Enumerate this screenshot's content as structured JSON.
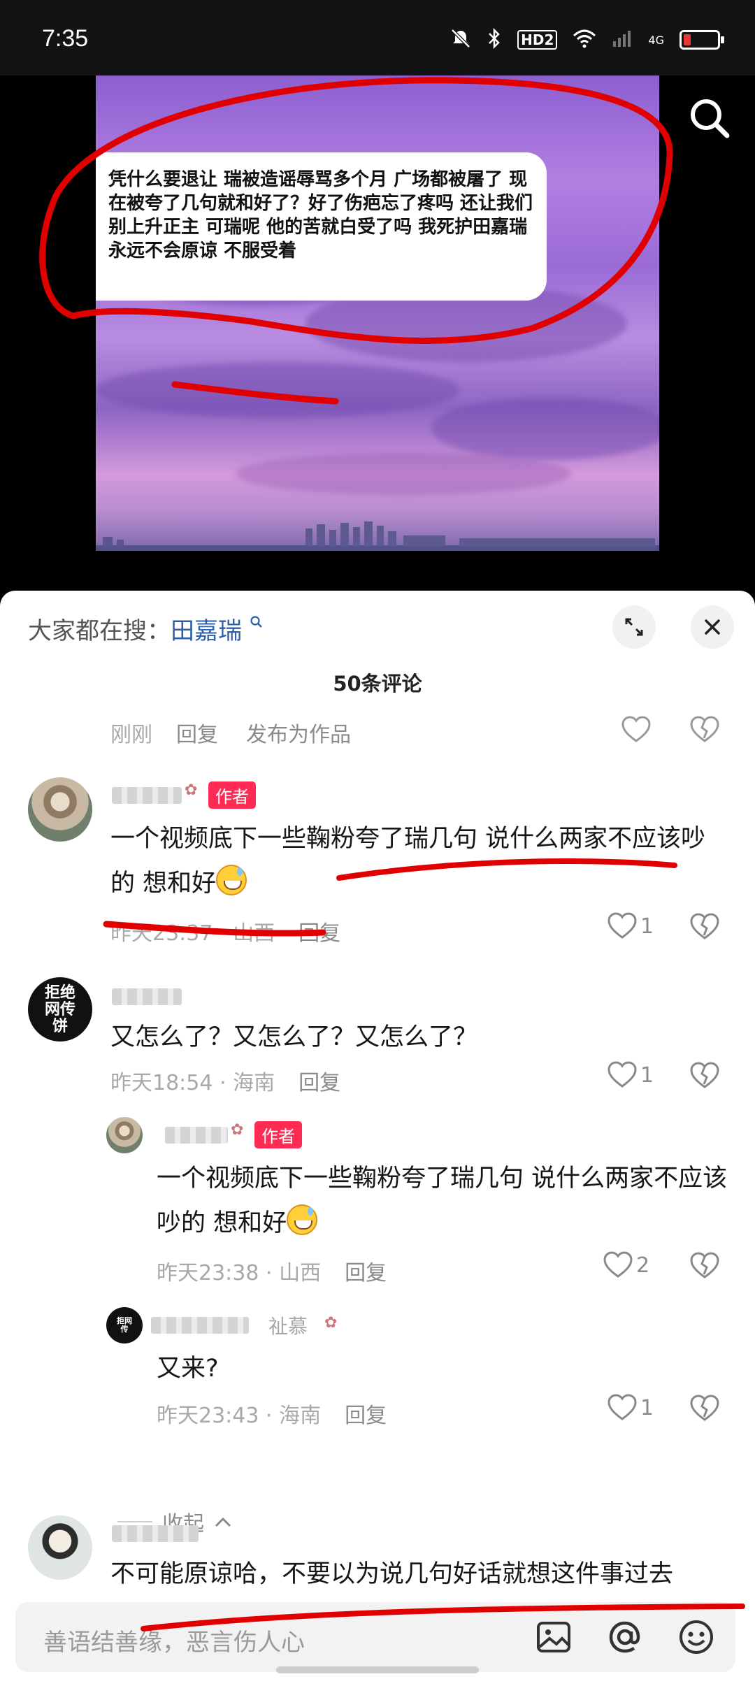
{
  "status_bar": {
    "time": "7:35",
    "hd_label": "HD2",
    "signal_label": "4G"
  },
  "video": {
    "overlay_text": "凭什么要退让 瑞被造谣辱骂多个月 广场都被屠了 现在被夸了几句就和好了？好了伤疤忘了疼吗 还让我们别上升正主 可瑞呢 他的苦就白受了吗 我死护田嘉瑞 永远不会原谅 不服受着"
  },
  "comments_panel": {
    "search_prefix": "大家都在搜：",
    "search_term": "田嘉瑞",
    "count_label": "50条评论",
    "top_row": {
      "time": "刚刚",
      "reply": "回复",
      "publish": "发布为作品"
    },
    "comments": [
      {
        "author_tag": "作者",
        "text": "一个视频底下一些鞠粉夸了瑞几句 说什么两家不应该吵的 想和好",
        "time": "昨天23:37 · 山西",
        "reply": "回复",
        "likes": "1"
      },
      {
        "avatar_text": "拒绝网传饼",
        "text": "又怎么了？又怎么了？又怎么了？",
        "time": "昨天18:54 · 海南",
        "reply": "回复",
        "likes": "1"
      },
      {
        "author_tag": "作者",
        "text": "一个视频底下一些鞠粉夸了瑞几句 说什么两家不应该吵的 想和好",
        "time": "昨天23:38 · 山西",
        "reply": "回复",
        "likes": "2"
      },
      {
        "avatar_text": "拒网传",
        "reply_to": "祉慕",
        "text": "又来?",
        "time": "昨天23:43 · 海南",
        "reply": "回复",
        "likes": "1"
      },
      {
        "text": "不可能原谅哈，不要以为说几句好话就想这件事过去"
      }
    ],
    "collapse_label": "收起"
  },
  "input_bar": {
    "placeholder": "善语结善缘，恶言伤人心"
  },
  "colors": {
    "accent": "#fe2c55",
    "link": "#2d5fa8",
    "annotation": "#e00000"
  },
  "icons": [
    "mute-icon",
    "bluetooth-icon",
    "wifi-icon",
    "battery-icon",
    "search-icon",
    "expand-icon",
    "close-icon",
    "heart-icon",
    "broken-heart-icon",
    "image-icon",
    "at-icon",
    "emoji-icon"
  ]
}
